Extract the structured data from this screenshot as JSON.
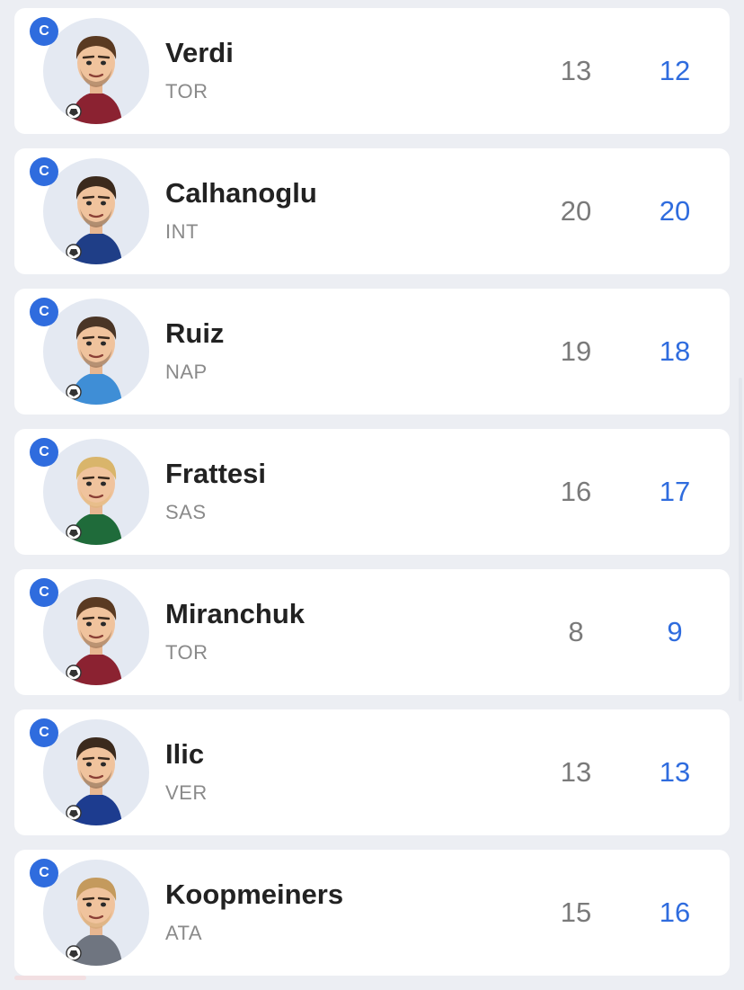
{
  "players": [
    {
      "badge": "C",
      "name": "Verdi",
      "team": "TOR",
      "stat_left": "13",
      "stat_right": "12",
      "avatar_icon": "player-caricature",
      "kit_color": "#8b2231",
      "hair_color": "#5a3a22"
    },
    {
      "badge": "C",
      "name": "Calhanoglu",
      "team": "INT",
      "stat_left": "20",
      "stat_right": "20",
      "avatar_icon": "player-caricature",
      "kit_color": "#1f3e87",
      "hair_color": "#3b2a1d"
    },
    {
      "badge": "C",
      "name": "Ruiz",
      "team": "NAP",
      "stat_left": "19",
      "stat_right": "18",
      "avatar_icon": "player-caricature",
      "kit_color": "#3f8ed6",
      "hair_color": "#4a3526"
    },
    {
      "badge": "C",
      "name": "Frattesi",
      "team": "SAS",
      "stat_left": "16",
      "stat_right": "17",
      "avatar_icon": "player-caricature",
      "kit_color": "#1f6b3a",
      "hair_color": "#d9b56b"
    },
    {
      "badge": "C",
      "name": "Miranchuk",
      "team": "TOR",
      "stat_left": "8",
      "stat_right": "9",
      "avatar_icon": "player-caricature",
      "kit_color": "#8b2231",
      "hair_color": "#5a3a22"
    },
    {
      "badge": "C",
      "name": "Ilic",
      "team": "VER",
      "stat_left": "13",
      "stat_right": "13",
      "avatar_icon": "player-caricature",
      "kit_color": "#1d3c8f",
      "hair_color": "#3b2a1d"
    },
    {
      "badge": "C",
      "name": "Koopmeiners",
      "team": "ATA",
      "stat_left": "15",
      "stat_right": "16",
      "avatar_icon": "player-caricature",
      "kit_color": "#6f7580",
      "hair_color": "#c49a5d"
    }
  ],
  "colors": {
    "accent": "#2f6cde",
    "background": "#eceef3",
    "card": "#ffffff",
    "name_text": "#222222",
    "muted_text": "#8a8a8a"
  }
}
